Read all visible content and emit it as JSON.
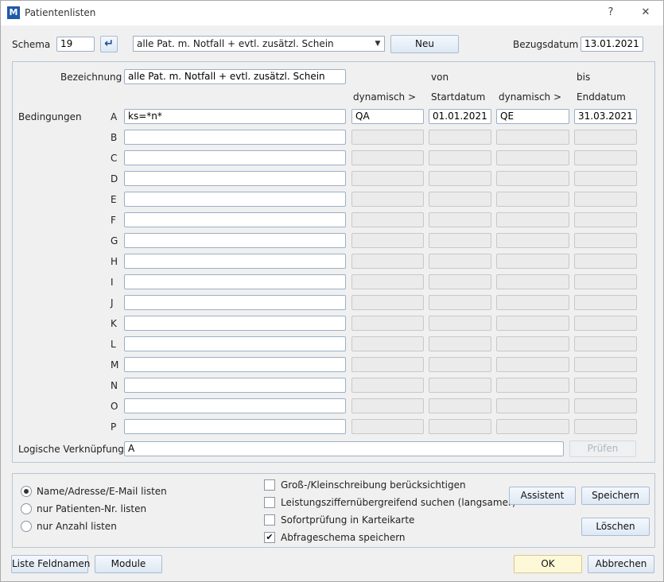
{
  "window": {
    "title": "Patientenlisten",
    "help": "?",
    "close": "✕",
    "logo": "M"
  },
  "top": {
    "schema_label": "Schema",
    "schema_value": "19",
    "enter_icon": "↵",
    "selected_schema": "alle Pat. m. Notfall + evtl. zusätzl. Schein",
    "new_button": "Neu",
    "bezugsdatum_label": "Bezugsdatum",
    "bezugsdatum_value": "13.01.2021"
  },
  "conditions": {
    "bezeichnung_label": "Bezeichnung",
    "bezeichnung_value": "alle Pat. m. Notfall + evtl. zusätzl. Schein",
    "von_label": "von",
    "bis_label": "bis",
    "col_dyn1": "dynamisch >",
    "col_start": "Startdatum",
    "col_dyn2": "dynamisch >",
    "col_end": "Enddatum",
    "bedingungen_label": "Bedingungen",
    "rows": [
      {
        "letter": "A",
        "cond": "ks=*n*",
        "dyn1": "QA",
        "start": "01.01.2021",
        "dyn2": "QE",
        "end": "31.03.2021"
      },
      {
        "letter": "B",
        "cond": "",
        "dyn1": "",
        "start": "",
        "dyn2": "",
        "end": ""
      },
      {
        "letter": "C",
        "cond": "",
        "dyn1": "",
        "start": "",
        "dyn2": "",
        "end": ""
      },
      {
        "letter": "D",
        "cond": "",
        "dyn1": "",
        "start": "",
        "dyn2": "",
        "end": ""
      },
      {
        "letter": "E",
        "cond": "",
        "dyn1": "",
        "start": "",
        "dyn2": "",
        "end": ""
      },
      {
        "letter": "F",
        "cond": "",
        "dyn1": "",
        "start": "",
        "dyn2": "",
        "end": ""
      },
      {
        "letter": "G",
        "cond": "",
        "dyn1": "",
        "start": "",
        "dyn2": "",
        "end": ""
      },
      {
        "letter": "H",
        "cond": "",
        "dyn1": "",
        "start": "",
        "dyn2": "",
        "end": ""
      },
      {
        "letter": "I",
        "cond": "",
        "dyn1": "",
        "start": "",
        "dyn2": "",
        "end": ""
      },
      {
        "letter": "J",
        "cond": "",
        "dyn1": "",
        "start": "",
        "dyn2": "",
        "end": ""
      },
      {
        "letter": "K",
        "cond": "",
        "dyn1": "",
        "start": "",
        "dyn2": "",
        "end": ""
      },
      {
        "letter": "L",
        "cond": "",
        "dyn1": "",
        "start": "",
        "dyn2": "",
        "end": ""
      },
      {
        "letter": "M",
        "cond": "",
        "dyn1": "",
        "start": "",
        "dyn2": "",
        "end": ""
      },
      {
        "letter": "N",
        "cond": "",
        "dyn1": "",
        "start": "",
        "dyn2": "",
        "end": ""
      },
      {
        "letter": "O",
        "cond": "",
        "dyn1": "",
        "start": "",
        "dyn2": "",
        "end": ""
      },
      {
        "letter": "P",
        "cond": "",
        "dyn1": "",
        "start": "",
        "dyn2": "",
        "end": ""
      }
    ],
    "logic_label": "Logische Verknüpfung",
    "logic_value": "A",
    "pruefen_button": "Prüfen"
  },
  "options": {
    "radios": [
      {
        "label": "Name/Adresse/E-Mail listen",
        "checked": true
      },
      {
        "label": "nur Patienten-Nr. listen",
        "checked": false
      },
      {
        "label": "nur Anzahl listen",
        "checked": false
      }
    ],
    "checkboxes": [
      {
        "label": "Groß-/Kleinschreibung berücksichtigen",
        "checked": false
      },
      {
        "label": "Leistungsziffernübergreifend suchen (langsamer)",
        "checked": false
      },
      {
        "label": "Sofortprüfung in Karteikarte",
        "checked": false
      },
      {
        "label": "Abfrageschema speichern",
        "checked": true
      }
    ],
    "assistent_button": "Assistent",
    "speichern_button": "Speichern",
    "loeschen_button": "Löschen"
  },
  "footer": {
    "feldnamen_button": "Liste Feldnamen",
    "module_button": "Module",
    "ok_button": "OK",
    "abbrechen_button": "Abbrechen"
  },
  "colors": {
    "accent": "#1f5aa6",
    "ok_button_bg": "#fdf8d8",
    "disabled_field": "#ebebeb"
  }
}
